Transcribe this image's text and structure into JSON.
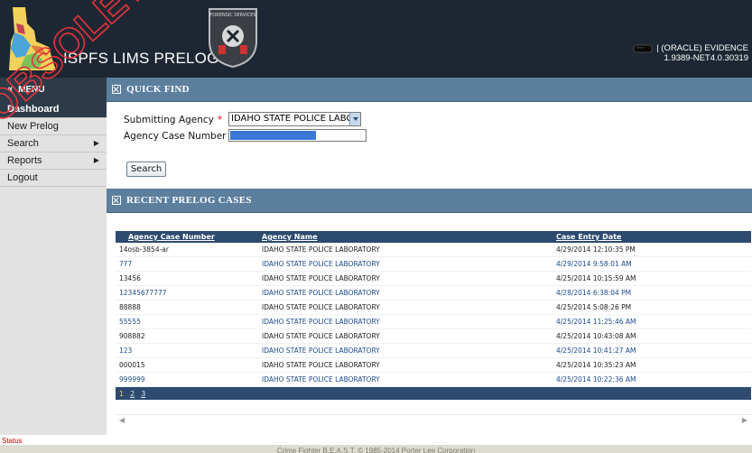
{
  "header": {
    "app_title": "ISPFS LIMS PRELOG",
    "badge_text": "FORENSIC SERVICES",
    "db_label": "| (ORACLE) EVIDENCE",
    "version": "1.9389-NET4.0.30319"
  },
  "menu": {
    "heading": "MENU",
    "items": [
      {
        "label": "Dashboard",
        "active": true,
        "has_submenu": false
      },
      {
        "label": "New Prelog",
        "active": false,
        "has_submenu": false
      },
      {
        "label": "Search",
        "active": false,
        "has_submenu": true
      },
      {
        "label": "Reports",
        "active": false,
        "has_submenu": true
      },
      {
        "label": "Logout",
        "active": false,
        "has_submenu": false
      }
    ]
  },
  "quick_find": {
    "title": "QUICK FIND",
    "submitting_agency_label": "Submitting Agency",
    "submitting_agency_value": "IDAHO STATE POLICE LABC",
    "agency_case_number_label": "Agency Case Number",
    "required_mark": "*",
    "search_button": "Search"
  },
  "recent": {
    "title": "RECENT PRELOG CASES",
    "columns": [
      "Agency Case Number",
      "Agency Name",
      "Case Entry Date"
    ],
    "rows": [
      {
        "case": "14osb-3854-ar",
        "agency": "IDAHO STATE POLICE LABORATORY",
        "date": "4/29/2014 12:10:35 PM",
        "style": "plain"
      },
      {
        "case": "777",
        "agency": "IDAHO STATE POLICE LABORATORY",
        "date": "4/29/2014 9:58:01 AM",
        "style": "link"
      },
      {
        "case": "13456",
        "agency": "IDAHO STATE POLICE LABORATORY",
        "date": "4/25/2014 10:15:59 AM",
        "style": "plain"
      },
      {
        "case": "12345677777",
        "agency": "IDAHO STATE POLICE LABORATORY",
        "date": "4/28/2014 6:38:04 PM",
        "style": "link"
      },
      {
        "case": "88888",
        "agency": "IDAHO STATE POLICE LABORATORY",
        "date": "4/25/2014 5:08:26 PM",
        "style": "plain"
      },
      {
        "case": "55555",
        "agency": "IDAHO STATE POLICE LABORATORY",
        "date": "4/25/2014 11:25:46 AM",
        "style": "link"
      },
      {
        "case": "908882",
        "agency": "IDAHO STATE POLICE LABORATORY",
        "date": "4/25/2014 10:43:08 AM",
        "style": "plain"
      },
      {
        "case": "123",
        "agency": "IDAHO STATE POLICE LABORATORY",
        "date": "4/25/2014 10:41:27 AM",
        "style": "link"
      },
      {
        "case": "000015",
        "agency": "IDAHO STATE POLICE LABORATORY",
        "date": "4/25/2014 10:35:23 AM",
        "style": "plain"
      },
      {
        "case": "999999",
        "agency": "IDAHO STATE POLICE LABORATORY",
        "date": "4/25/2014 10:22:36 AM",
        "style": "link"
      }
    ],
    "pages": [
      "1",
      "2",
      "3"
    ],
    "current_page": "1"
  },
  "status_label": "Status",
  "footer": "Crime Fighter B.E.A.S.T. © 1985-2014 Porter Lee Corporation",
  "watermark": "OBSOLETE",
  "colors": {
    "header_bg": "#1d2733",
    "section_bar": "#5c7f9e",
    "table_header": "#2d4a6f",
    "link": "#1e4a8c",
    "watermark": "#e8333a"
  }
}
